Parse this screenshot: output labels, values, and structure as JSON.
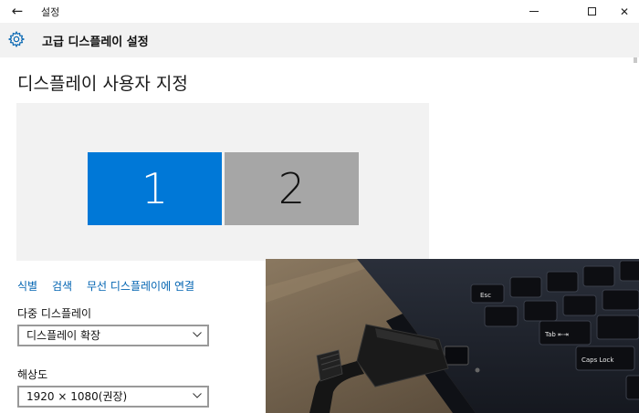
{
  "window": {
    "back_glyph": "←",
    "title": "설정",
    "minimize_glyph": "—",
    "close_glyph": "✕"
  },
  "header": {
    "icon": "gear-icon",
    "title": "고급 디스플레이 설정"
  },
  "main": {
    "page_title": "디스플레이 사용자 지정",
    "monitors": [
      {
        "label": "1",
        "selected": true,
        "color": "#0078d7"
      },
      {
        "label": "2",
        "selected": false,
        "color": "#a6a6a6"
      }
    ],
    "links": {
      "identify": "식별",
      "detect": "검색",
      "connect": "무선 디스플레이에 연결"
    },
    "multi_display": {
      "label": "다중 디스플레이",
      "value": "디스플레이 확장"
    },
    "resolution": {
      "label": "해상도",
      "value": "1920 × 1080(권장)"
    }
  },
  "photo": {
    "keys": [
      "Esc",
      "Tab ⇤⇥",
      "Caps Lock"
    ]
  },
  "colors": {
    "accent": "#0078d7",
    "link": "#0063b1",
    "header_bg": "#f2f2f2",
    "preview_bg": "#f2f2f2"
  }
}
